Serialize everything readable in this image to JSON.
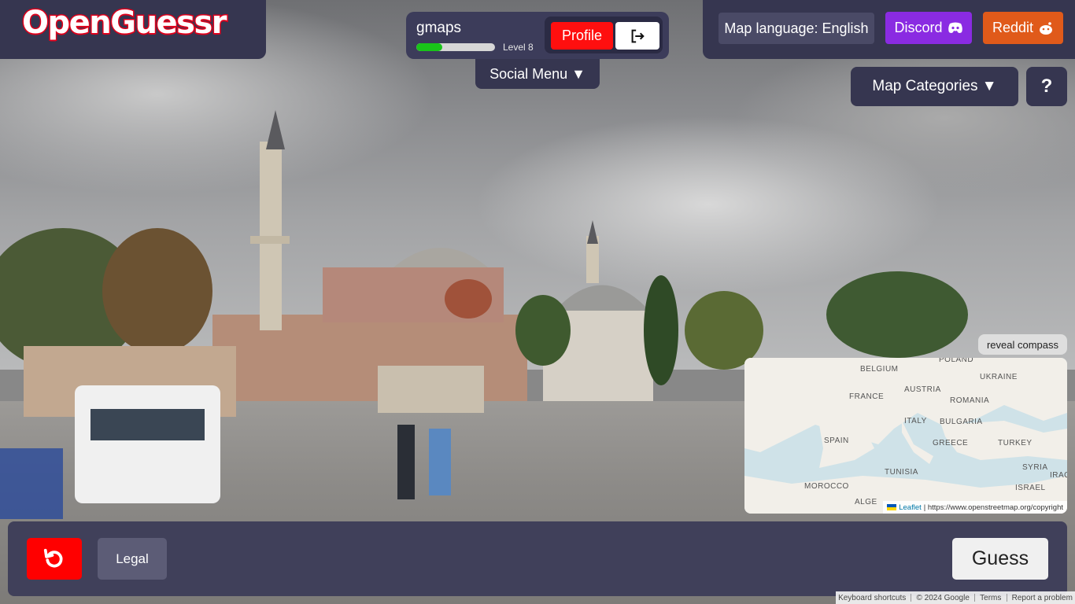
{
  "logo": {
    "text": "OpenGuessr"
  },
  "user": {
    "name": "gmaps",
    "level_label": "Level 8",
    "xp_progress": 0.33
  },
  "buttons": {
    "profile": "Profile",
    "social_menu": "Social Menu ▼",
    "map_language": "Map language: English",
    "discord": "Discord",
    "reddit": "Reddit",
    "map_categories": "Map Categories ▼",
    "help": "?",
    "reveal_compass": "reveal compass",
    "legal": "Legal",
    "guess": "Guess"
  },
  "minimap": {
    "labels": [
      "POLAND",
      "BELGIUM",
      "UKRAINE",
      "FRANCE",
      "AUSTRIA",
      "ROMANIA",
      "ITALY",
      "BULGARIA",
      "SPAIN",
      "GREECE",
      "TURKEY",
      "TUNISIA",
      "SYRIA",
      "MOROCCO",
      "ISRAEL",
      "ALGE",
      "IRAQ"
    ],
    "attribution_link": "Leaflet",
    "attribution_text": "| https://www.openstreetmap.org/copyright"
  },
  "footer": {
    "keyboard": "Keyboard shortcuts",
    "copyright": "© 2024 Google",
    "terms": "Terms",
    "report": "Report a problem"
  },
  "colors": {
    "panel": "#363650",
    "profile_red": "#ff0f0f",
    "discord": "#8a2be2",
    "reddit": "#e05a1a",
    "xp_green": "#19c419"
  },
  "icons": [
    "logout-icon",
    "discord-icon",
    "reddit-icon",
    "undo-icon"
  ]
}
